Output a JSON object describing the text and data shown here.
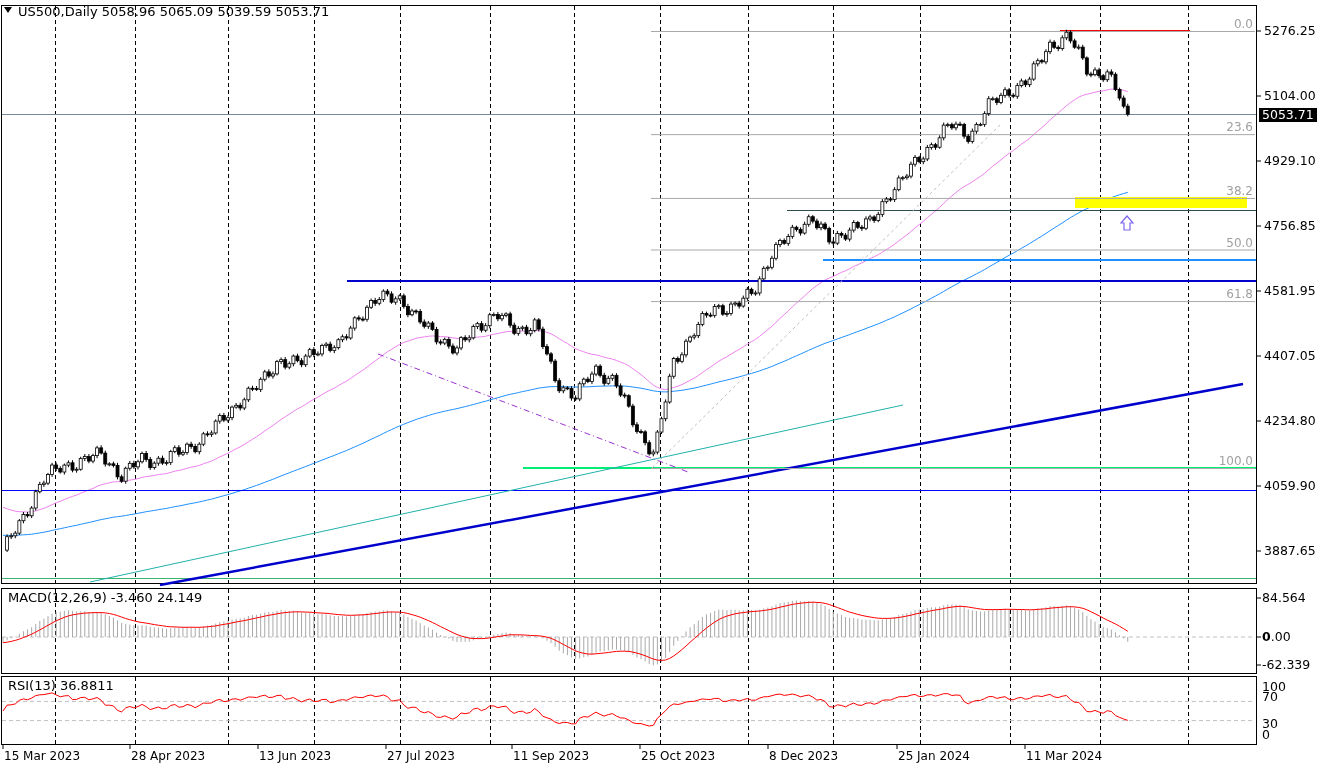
{
  "chart_header": {
    "symbol": "US500,Daily",
    "ohlc": "5058.96 5065.09 5039.59 5053.71"
  },
  "main_chart": {
    "price_axis": [
      "5276.25",
      "5104.00",
      "4929.10",
      "4756.85",
      "4581.95",
      "4407.05",
      "4234.80",
      "4059.90",
      "3887.65"
    ],
    "current_price": "5053.71",
    "fib_levels": [
      {
        "label": "0.0"
      },
      {
        "label": "23.6"
      },
      {
        "label": "38.2"
      },
      {
        "label": "50.0"
      },
      {
        "label": "61.8"
      },
      {
        "label": "100.0"
      }
    ]
  },
  "macd_panel": {
    "title": "MACD(12,26,9) -3.460 24.149",
    "scale": [
      "84.564",
      "**0**.00",
      "-62.339"
    ]
  },
  "rsi_panel": {
    "title": "RSI(13) 36.8811",
    "scale": [
      "100",
      "70",
      "30",
      "0"
    ]
  },
  "time_axis": [
    "15 Mar 2023",
    "28 Apr 2023",
    "13 Jun 2023",
    "27 Jul 2023",
    "11 Sep 2023",
    "25 Oct 2023",
    "8 Dec 2023",
    "25 Jan 2024",
    "11 Mar 2024"
  ]
}
